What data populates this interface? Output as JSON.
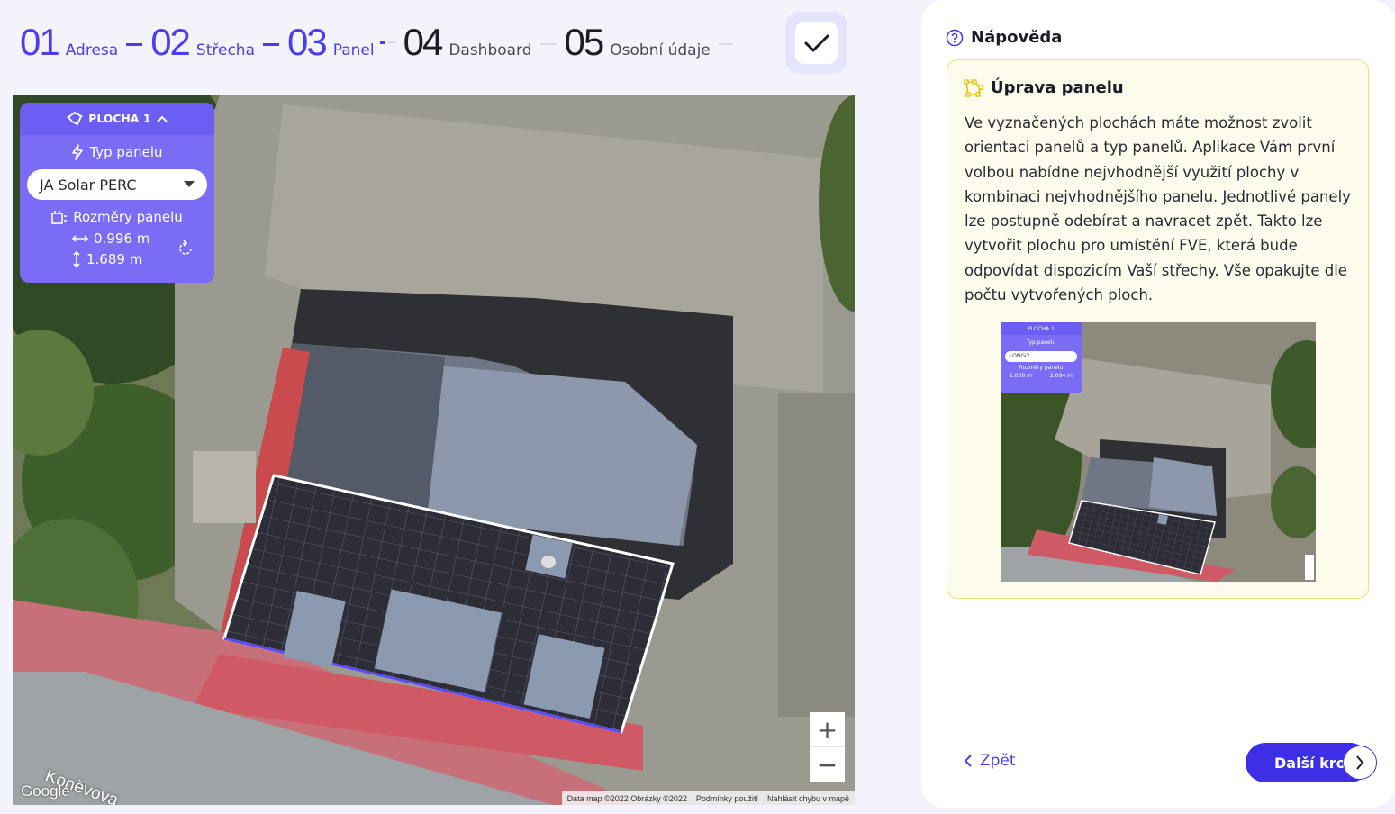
{
  "stepper": {
    "steps": [
      {
        "num": "01",
        "label": "Adresa",
        "state": "done"
      },
      {
        "num": "02",
        "label": "Střecha",
        "state": "done"
      },
      {
        "num": "03",
        "label": "Panel",
        "state": "current"
      },
      {
        "num": "04",
        "label": "Dashboard",
        "state": "todo"
      },
      {
        "num": "05",
        "label": "Osobní údaje",
        "state": "todo"
      }
    ],
    "confirm_icon": "check-icon"
  },
  "map_panel": {
    "area_label": "PLOCHA 1",
    "type_label": "Typ panelu",
    "selected_panel": "JA Solar PERC",
    "dims_label": "Rozměry panelu",
    "width": "0.996 m",
    "height": "1.689 m"
  },
  "map": {
    "street": "Koněvova",
    "google": "Google",
    "attribution": [
      "Data map ©2022 Obrázky ©2022",
      "Podmínky použití",
      "Nahlásit chybu v mapě"
    ],
    "zoom_in": "+",
    "zoom_out": "−"
  },
  "help": {
    "title": "Nápověda",
    "box_title": "Úprava panelu",
    "text": "Ve vyznačených plochách máte možnost zvolit orientaci panelů a typ panelů. Aplikace Vám první volbou nabídne nejvhodnější využití plochy v kombinaci nejvhodnějšího panelu. Jednotlivé panely lze postupně odebírat a navracet zpět. Takto lze vytvořit plochu pro umístění FVE, která bude odpovídat dispozicím Vaší střechy. Vše opakujte dle počtu vytvořených ploch."
  },
  "thumb": {
    "area_label": "PLOCHA 1",
    "type_label": "Typ panelu",
    "selected_panel": "LONGi2",
    "dims_label": "Rozměry panelu",
    "width": "1.038 m",
    "height": "2.094 m"
  },
  "nav": {
    "back": "Zpět",
    "next": "Další krok"
  },
  "colors": {
    "accent": "#4b3df0",
    "panel_card": "#7a6cf5",
    "help_box_bg": "#fdfcec",
    "help_box_border": "#ebe27a"
  }
}
